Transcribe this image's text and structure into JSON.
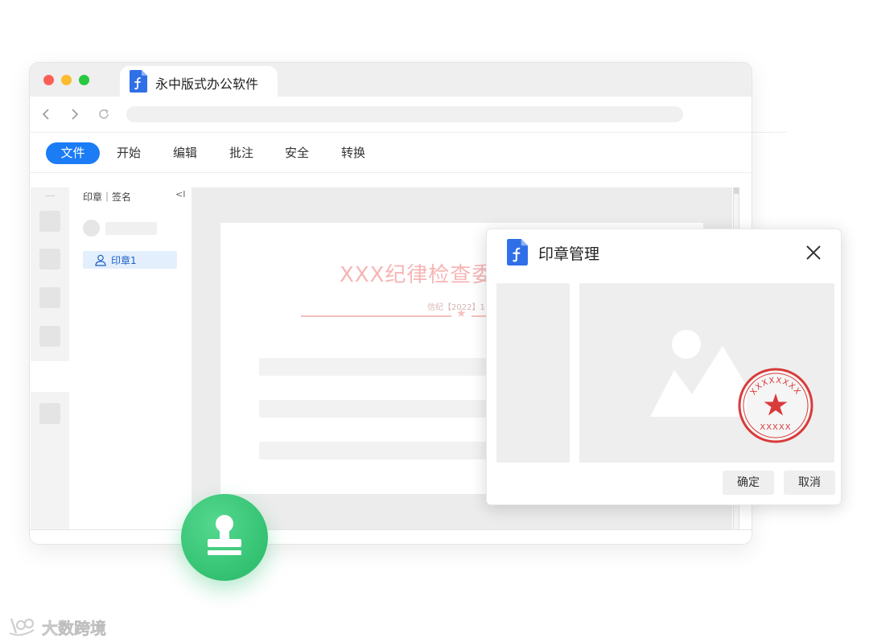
{
  "app": {
    "tab_title": "永中版式办公软件"
  },
  "menu": {
    "items": [
      "文件",
      "开始",
      "编辑",
      "批注",
      "安全",
      "转换"
    ],
    "active_index": 0
  },
  "panel": {
    "title": "印章｜签名",
    "collapse_glyph": "<I",
    "seal_item": "印章1"
  },
  "document": {
    "title": "XXX纪律检查委",
    "number": "信纪【2022】1"
  },
  "dialog": {
    "title": "印章管理",
    "confirm_label": "确定",
    "cancel_label": "取消"
  },
  "seal": {
    "top_text": "XXXXXXXX",
    "bottom_text": "XXXXX",
    "color": "#d93a3a"
  },
  "watermark": {
    "text": "大数跨境"
  },
  "colors": {
    "accent": "#1b7cf5",
    "stamp_green": "#2dc06e",
    "seal_red": "#d93a3a"
  }
}
